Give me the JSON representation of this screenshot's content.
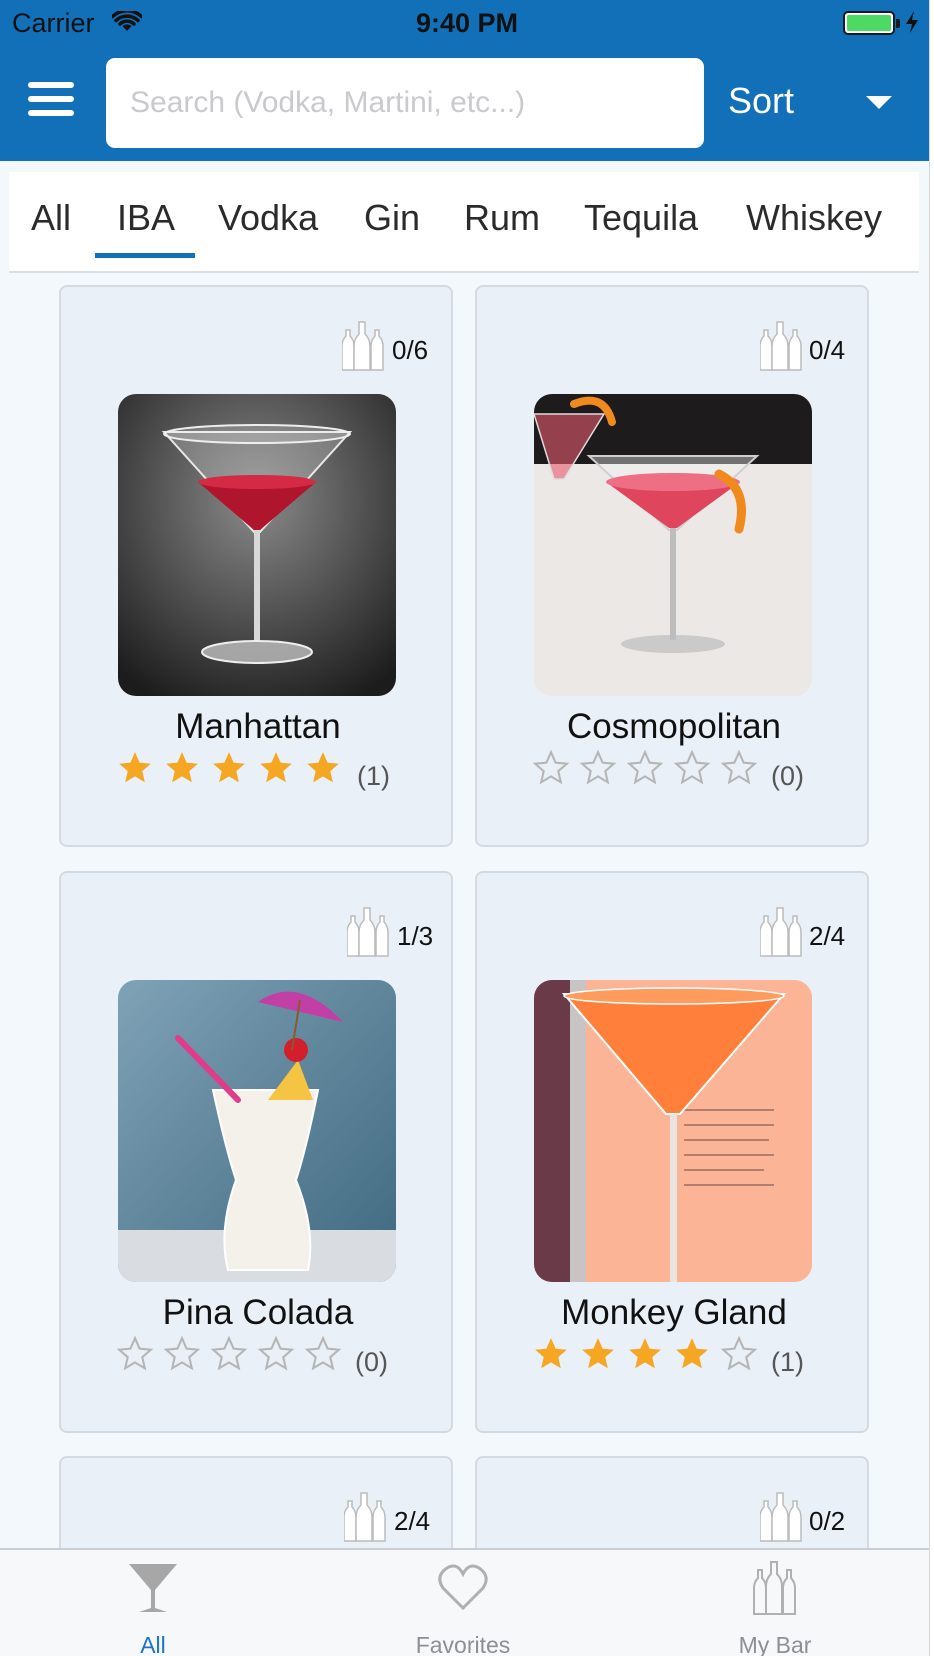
{
  "status_bar": {
    "carrier": "Carrier",
    "time": "9:40 PM"
  },
  "header": {
    "search_placeholder": "Search (Vodka, Martini, etc...)",
    "sort_label": "Sort",
    "accent_color": "#1270b8"
  },
  "tabs": [
    {
      "label": "All",
      "active": false
    },
    {
      "label": "IBA",
      "active": true
    },
    {
      "label": "Vodka",
      "active": false
    },
    {
      "label": "Gin",
      "active": false
    },
    {
      "label": "Rum",
      "active": false
    },
    {
      "label": "Tequila",
      "active": false
    },
    {
      "label": "Whiskey",
      "active": false
    }
  ],
  "cocktails": [
    {
      "name": "Manhattan",
      "ingredients": "0/6",
      "rating": 5,
      "rating_count": "(1)"
    },
    {
      "name": "Cosmopolitan",
      "ingredients": "0/4",
      "rating": 0,
      "rating_count": "(0)"
    },
    {
      "name": "Pina Colada",
      "ingredients": "1/3",
      "rating": 0,
      "rating_count": "(0)"
    },
    {
      "name": "Monkey Gland",
      "ingredients": "2/4",
      "rating": 4,
      "rating_count": "(1)"
    },
    {
      "name": "",
      "ingredients": "2/4"
    },
    {
      "name": "",
      "ingredients": "0/2"
    }
  ],
  "tab_bar": {
    "items": [
      {
        "label": "All",
        "icon": "cocktail-glass-icon",
        "active": true
      },
      {
        "label": "Favorites",
        "icon": "heart-icon",
        "active": false
      },
      {
        "label": "My Bar",
        "icon": "bottles-icon",
        "active": false
      }
    ],
    "active_color": "#1a74c9",
    "inactive_color": "#8e8e93"
  },
  "star_color": "#f5a623"
}
